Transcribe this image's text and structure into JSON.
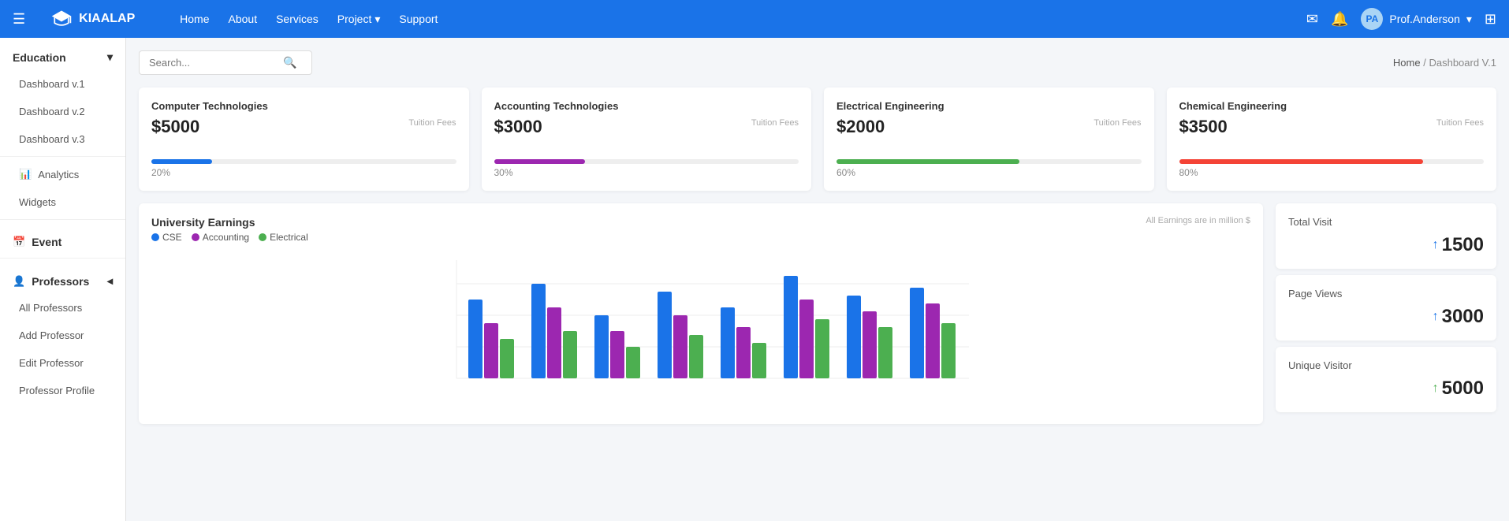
{
  "brand": {
    "name": "KIAALAP",
    "logo_alt": "graduation-cap"
  },
  "topnav": {
    "hamburger_label": "☰",
    "links": [
      {
        "label": "Home",
        "has_dropdown": false
      },
      {
        "label": "About",
        "has_dropdown": false
      },
      {
        "label": "Services",
        "has_dropdown": false
      },
      {
        "label": "Project",
        "has_dropdown": true
      },
      {
        "label": "Support",
        "has_dropdown": false
      }
    ],
    "icons": {
      "mail": "✉",
      "bell": "🔔",
      "grid": "⊞"
    },
    "user": {
      "name": "Prof.Anderson",
      "avatar_initials": "PA"
    }
  },
  "sidebar": {
    "education_label": "Education",
    "items_education": [
      {
        "label": "Dashboard v.1",
        "active": false
      },
      {
        "label": "Dashboard v.2",
        "active": false
      },
      {
        "label": "Dashboard v.3",
        "active": false
      },
      {
        "label": "Analytics",
        "icon": "📊",
        "active": false
      },
      {
        "label": "Widgets",
        "active": false
      }
    ],
    "event_label": "Event",
    "professors_label": "Professors",
    "items_professors": [
      {
        "label": "All Professors",
        "active": false
      },
      {
        "label": "Add Professor",
        "active": false
      },
      {
        "label": "Edit Professor",
        "active": false
      },
      {
        "label": "Professor Profile",
        "active": false
      }
    ]
  },
  "search": {
    "placeholder": "Search...",
    "icon": "🔍"
  },
  "breadcrumb": {
    "home": "Home",
    "separator": "/",
    "current": "Dashboard V.1"
  },
  "stat_cards": [
    {
      "title": "Computer Technologies",
      "amount": "$5000",
      "label": "Tuition Fees",
      "percent": 20,
      "percent_label": "20%",
      "bar_color": "#1a73e8"
    },
    {
      "title": "Accounting Technologies",
      "amount": "$3000",
      "label": "Tuition Fees",
      "percent": 30,
      "percent_label": "30%",
      "bar_color": "#9c27b0"
    },
    {
      "title": "Electrical Engineering",
      "amount": "$2000",
      "label": "Tuition Fees",
      "percent": 60,
      "percent_label": "60%",
      "bar_color": "#4caf50"
    },
    {
      "title": "Chemical Engineering",
      "amount": "$3500",
      "label": "Tuition Fees",
      "percent": 80,
      "percent_label": "80%",
      "bar_color": "#f44336"
    }
  ],
  "chart": {
    "title": "University Earnings",
    "subtitle": "All Earnings are in million $",
    "legend": [
      {
        "label": "CSE",
        "color": "#1a73e8"
      },
      {
        "label": "Accounting",
        "color": "#9c27b0"
      },
      {
        "label": "Electrical",
        "color": "#4caf50"
      }
    ]
  },
  "visit_stats": [
    {
      "title": "Total Visit",
      "value": "1500",
      "arrow_color": "blue"
    },
    {
      "title": "Page Views",
      "value": "3000",
      "arrow_color": "blue"
    },
    {
      "title": "Unique Visitor",
      "value": "5000",
      "arrow_color": "green"
    }
  ]
}
